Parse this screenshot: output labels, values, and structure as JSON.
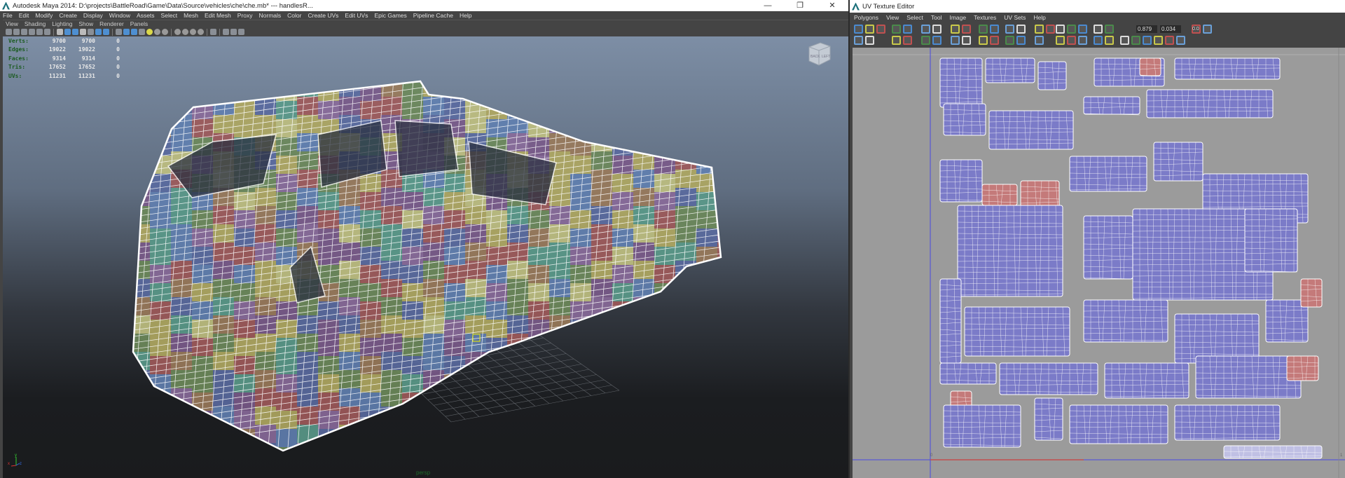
{
  "maya": {
    "title": "Autodesk Maya 2014: D:\\projects\\BattleRoad\\Game\\Data\\Source\\vehicles\\che\\che.mb*  ---  handlesR...",
    "window_buttons": {
      "minimize": "—",
      "restore": "❐",
      "close": "✕"
    },
    "menus": [
      "File",
      "Edit",
      "Modify",
      "Create",
      "Display",
      "Window",
      "Assets",
      "Select",
      "Mesh",
      "Edit Mesh",
      "Proxy",
      "Normals",
      "Color",
      "Create UVs",
      "Edit UVs",
      "Epic Games",
      "Pipeline Cache",
      "Help"
    ],
    "panel_menus": [
      "View",
      "Shading",
      "Lighting",
      "Show",
      "Renderer",
      "Panels"
    ],
    "hud": [
      {
        "label": "Verts:",
        "a": "9700",
        "b": "9700",
        "c": "0"
      },
      {
        "label": "Edges:",
        "a": "19022",
        "b": "19022",
        "c": "0"
      },
      {
        "label": "Faces:",
        "a": "9314",
        "b": "9314",
        "c": "0"
      },
      {
        "label": "Tris:",
        "a": "17652",
        "b": "17652",
        "c": "0"
      },
      {
        "label": "UVs:",
        "a": "11231",
        "b": "11231",
        "c": "0"
      }
    ],
    "camera_label": "persp",
    "viewcube": {
      "face1": "BACK",
      "face2": "LEFT"
    },
    "axis": {
      "x": "x",
      "y": "y",
      "z": "z"
    }
  },
  "uv_editor": {
    "title": "UV Texture Editor",
    "close": "✕",
    "menus": [
      "Polygons",
      "View",
      "Select",
      "Tool",
      "Image",
      "Textures",
      "UV Sets",
      "Help"
    ],
    "u_value": "0.879",
    "v_value": "0.034",
    "rotate_label": "0.0",
    "origin_label": "0",
    "one_label": "1"
  },
  "colors": {
    "uv_shell": "#7b7bc8",
    "uv_shell_selected": "#c47a7a",
    "grid_bg": "#9b9b9b",
    "u_axis": "#c25050",
    "v_axis": "#3a3ad0"
  }
}
